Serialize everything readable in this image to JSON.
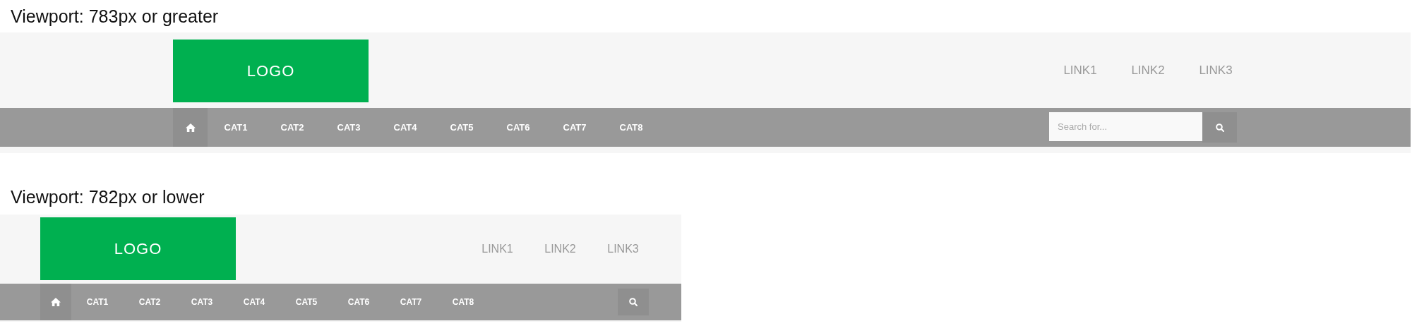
{
  "sections": [
    {
      "kind": "wide",
      "caption": "Viewport: 783px or greater",
      "logo": "LOGO",
      "links": [
        "LINK1",
        "LINK2",
        "LINK3"
      ],
      "categories": [
        "CAT1",
        "CAT2",
        "CAT3",
        "CAT4",
        "CAT5",
        "CAT6",
        "CAT7",
        "CAT8"
      ],
      "search": {
        "placeholder": "Search for..."
      }
    },
    {
      "kind": "compact",
      "caption": "Viewport: 782px or lower",
      "logo": "LOGO",
      "links": [
        "LINK1",
        "LINK2",
        "LINK3"
      ],
      "categories": [
        "CAT1",
        "CAT2",
        "CAT3",
        "CAT4",
        "CAT5",
        "CAT6",
        "CAT7",
        "CAT8"
      ]
    }
  ]
}
